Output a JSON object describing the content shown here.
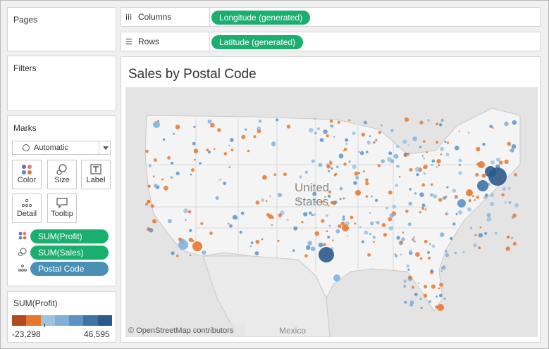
{
  "shelves": {
    "pages_title": "Pages",
    "filters_title": "Filters",
    "columns_label": "Columns",
    "columns_pill": "Longitude (generated)",
    "rows_label": "Rows",
    "rows_pill": "Latitude (generated)"
  },
  "marks": {
    "title": "Marks",
    "mark_type": "Automatic",
    "buttons": {
      "color": "Color",
      "size": "Size",
      "label": "Label",
      "detail": "Detail",
      "tooltip": "Tooltip"
    },
    "fields": [
      "SUM(Profit)",
      "SUM(Sales)",
      "Postal Code"
    ]
  },
  "legend": {
    "title": "SUM(Profit)",
    "min": "-23,298",
    "max": "46,595",
    "colors": [
      "#b04a23",
      "#e8772e",
      "#9cc3e0",
      "#80b0d8",
      "#5b93c6",
      "#3f73a5",
      "#2c5a8c"
    ]
  },
  "view": {
    "title": "Sales by Postal Code",
    "map_label_country": "United States",
    "map_label_mexico": "Mexico",
    "attribution": "© OpenStreetMap contributors"
  },
  "colors": {
    "pill_green": "#1aae6f",
    "pill_blue": "#4a90b5",
    "orange": "#e8772e",
    "blue_light": "#7fb2de",
    "blue_dark": "#2c5a8c"
  }
}
